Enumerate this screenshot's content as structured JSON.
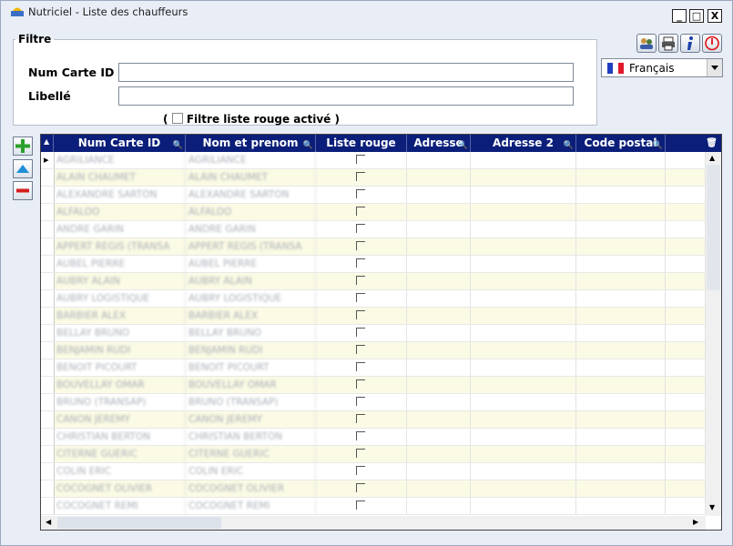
{
  "window": {
    "title": "Nutriciel - Liste des chauffeurs",
    "minimize": "_",
    "maximize": "□",
    "close": "X"
  },
  "filter": {
    "legend": "Filtre",
    "num_carte_label": "Num Carte ID",
    "num_carte_value": "",
    "libelle_label": "Libellé",
    "libelle_value": "",
    "red_list_open": "(",
    "red_list_text": "Filtre liste rouge activé",
    "red_list_close": ")"
  },
  "toolbar": {
    "icons": [
      "users-icon",
      "print-icon",
      "info-icon",
      "power-icon"
    ]
  },
  "language": {
    "selected": "Français",
    "flag": "france-flag-icon"
  },
  "side_buttons": [
    "add-icon",
    "up-icon",
    "remove-icon"
  ],
  "grid": {
    "columns": [
      "Num Carte ID",
      "Nom et prenom",
      "Liste rouge",
      "Adresse",
      "Adresse 2",
      "Code postal"
    ],
    "rows": [
      [
        "AGRILIANCE",
        "AGRILIANCE"
      ],
      [
        "ALAIN CHAUMET",
        "ALAIN CHAUMET"
      ],
      [
        "ALEXANDRE SARTON",
        "ALEXANDRE SARTON"
      ],
      [
        "ALFALOO",
        "ALFALOO"
      ],
      [
        "ANDRE GARIN",
        "ANDRE GARIN"
      ],
      [
        "APPERT REGIS (TRANSA",
        "APPERT REGIS (TRANSA"
      ],
      [
        "AUBEL PIERRE",
        "AUBEL PIERRE"
      ],
      [
        "AUBRY ALAIN",
        "AUBRY ALAIN"
      ],
      [
        "AUBRY LOGISTIQUE",
        "AUBRY LOGISTIQUE"
      ],
      [
        "BARBIER ALEX",
        "BARBIER ALEX"
      ],
      [
        "BELLAY BRUNO",
        "BELLAY BRUNO"
      ],
      [
        "BENJAMIN RUDI",
        "BENJAMIN RUDI"
      ],
      [
        "BENOIT PICOURT",
        "BENOIT PICOURT"
      ],
      [
        "BOUVELLAY OMAR",
        "BOUVELLAY OMAR"
      ],
      [
        "BRUNO (TRANSAP)",
        "BRUNO (TRANSAP)"
      ],
      [
        "CANON JEREMY",
        "CANON JEREMY"
      ],
      [
        "CHRISTIAN BERTON",
        "CHRISTIAN BERTON"
      ],
      [
        "CITERNE GUERIC",
        "CITERNE GUERIC"
      ],
      [
        "COLIN ERIC",
        "COLIN ERIC"
      ],
      [
        "COCOGNET OLIVIER",
        "COCOGNET OLIVIER"
      ],
      [
        "COCOGNET REMI",
        "COCOGNET REMI"
      ]
    ]
  },
  "colors": {
    "header_bg": "#0b1f7a",
    "row_alt": "#fbfae4",
    "window_bg": "#e9eef6"
  }
}
